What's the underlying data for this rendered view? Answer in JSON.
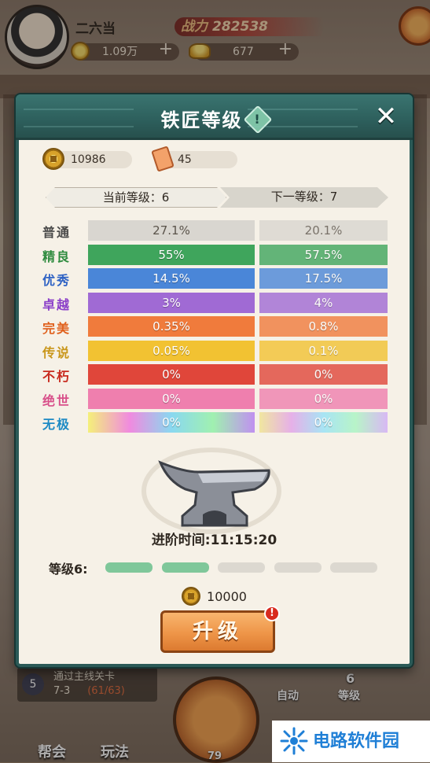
{
  "player": {
    "name": "二六当",
    "power_label": "战力",
    "power_value": "282538",
    "coins": "1.09万",
    "ingots": "677"
  },
  "dialog": {
    "title": "铁匠等级",
    "info_glyph": "!",
    "close_glyph": "✕",
    "resource_coin": "10986",
    "resource_scroll": "45",
    "current_level_label": "当前等级：6",
    "next_level_label": "下一等级：7",
    "qualities": [
      {
        "name": "普通",
        "current": "27.1%",
        "next": "20.1%",
        "color": "#d9d6d0",
        "text_color": "#5a534a",
        "name_color": "#4a4a4a"
      },
      {
        "name": "精良",
        "current": "55%",
        "next": "57.5%",
        "color": "#3fa55c",
        "text_color": "#ffffff",
        "name_color": "#2e8b3e"
      },
      {
        "name": "优秀",
        "current": "14.5%",
        "next": "17.5%",
        "color": "#4a86d8",
        "text_color": "#ffffff",
        "name_color": "#2e62c4"
      },
      {
        "name": "卓越",
        "current": "3%",
        "next": "4%",
        "color": "#a06ad4",
        "text_color": "#ffffff",
        "name_color": "#8a3ec8"
      },
      {
        "name": "完美",
        "current": "0.35%",
        "next": "0.8%",
        "color": "#f07b3c",
        "text_color": "#ffffff",
        "name_color": "#e0601c"
      },
      {
        "name": "传说",
        "current": "0.05%",
        "next": "0.1%",
        "color": "#f2c232",
        "text_color": "#ffffff",
        "name_color": "#c9961a"
      },
      {
        "name": "不朽",
        "current": "0%",
        "next": "0%",
        "color": "#e0463a",
        "text_color": "#ffffff",
        "name_color": "#c82a1e"
      },
      {
        "name": "绝世",
        "current": "0%",
        "next": "0%",
        "color": "#ef7fae",
        "text_color": "#ffffff",
        "name_color": "#d8508a"
      },
      {
        "name": "无极",
        "current": "0%",
        "next": "0%",
        "color": "rainbow",
        "text_color": "#ffffff",
        "name_color": "#1d8ac4"
      }
    ],
    "upgrade_time_label": "进阶时间:11:15:20",
    "level_progress_label": "等级6:",
    "level_progress": {
      "filled": 2,
      "total": 5
    },
    "upgrade_cost": "10000",
    "upgrade_button": "升级",
    "badge_glyph": "!"
  },
  "bottom": {
    "quest_num": "5",
    "quest_title": "通过主线关卡",
    "quest_stage": "7-3",
    "quest_progress": "(61/63)",
    "auto_label": "自动",
    "level_num": "6",
    "level_label": "等级",
    "guild_label": "帮会",
    "play_label": "玩法",
    "forge_num": "79"
  },
  "watermark": {
    "text": "电路软件园"
  },
  "colors": {
    "dialog_border": "#2b5a57",
    "dialog_bg": "#f6f1e7",
    "upgrade_button": "#ee9548",
    "progress_filled": "#7fc79a",
    "progress_empty": "#dcd8d0"
  }
}
